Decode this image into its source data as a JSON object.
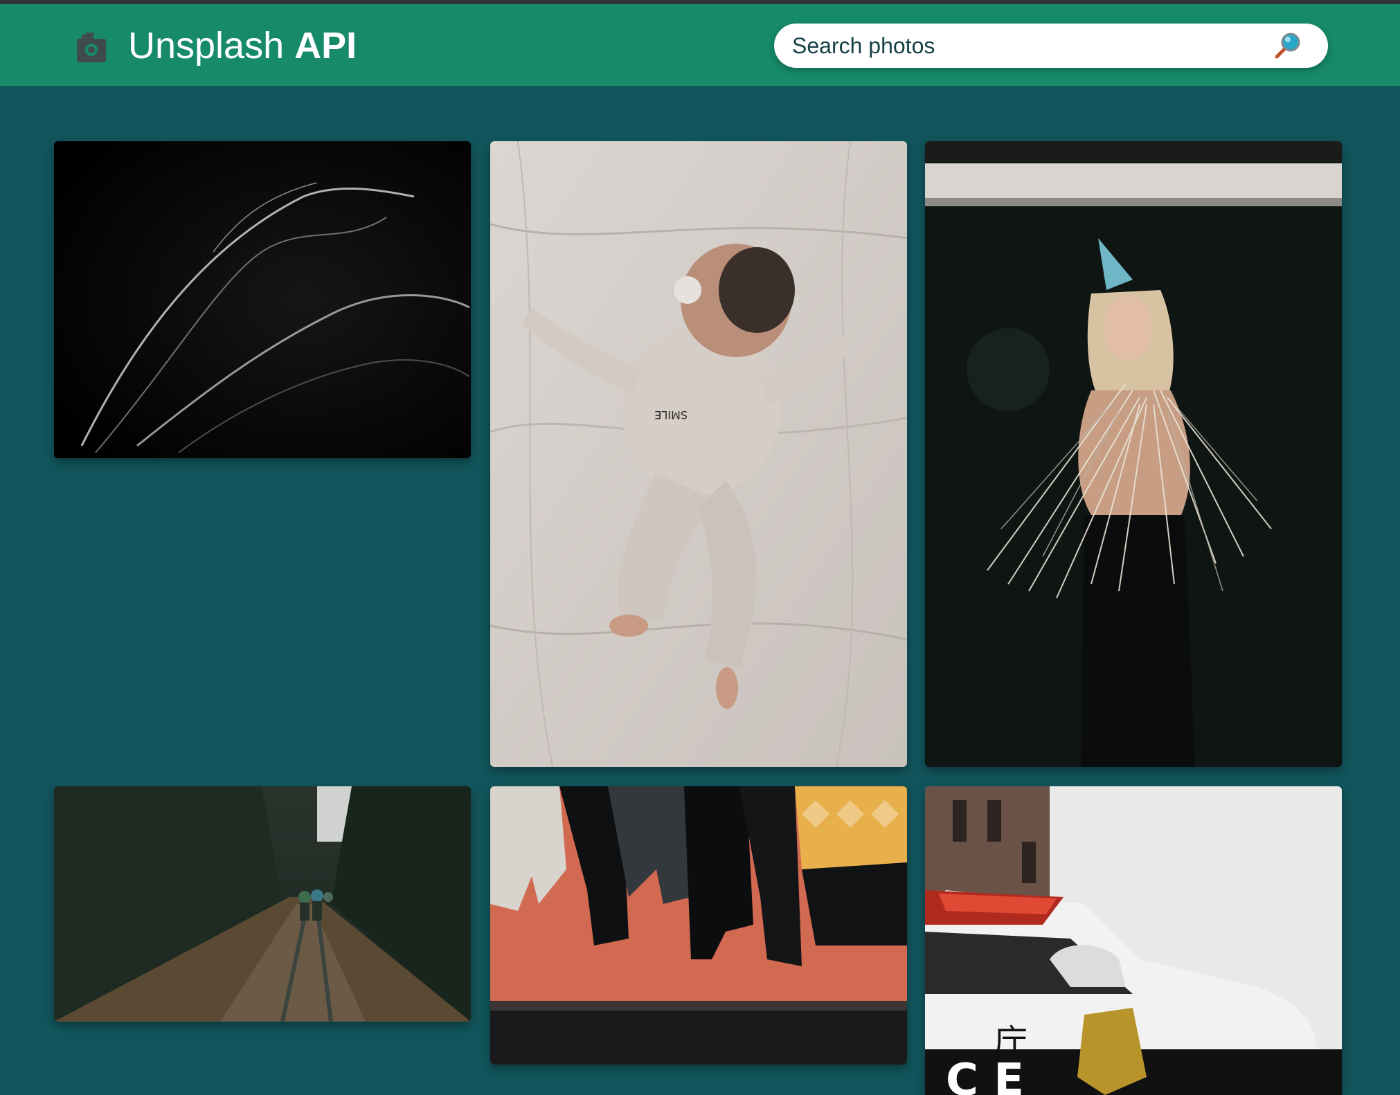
{
  "header": {
    "brand_light": "Unsplash",
    "brand_bold": "API",
    "logo_icon": "camera-icon",
    "background": "#168a69"
  },
  "search": {
    "placeholder": "Search photos",
    "value": "",
    "icon": "magnifier-icon"
  },
  "gallery": {
    "background": "#12555c",
    "photos": [
      {
        "subject": "smoke-abstract"
      },
      {
        "subject": "baby-on-bed"
      },
      {
        "subject": "party-woman-tinsel"
      },
      {
        "subject": "forest-cyclists"
      },
      {
        "subject": "hanging-clothes"
      },
      {
        "subject": "police-car"
      }
    ]
  }
}
